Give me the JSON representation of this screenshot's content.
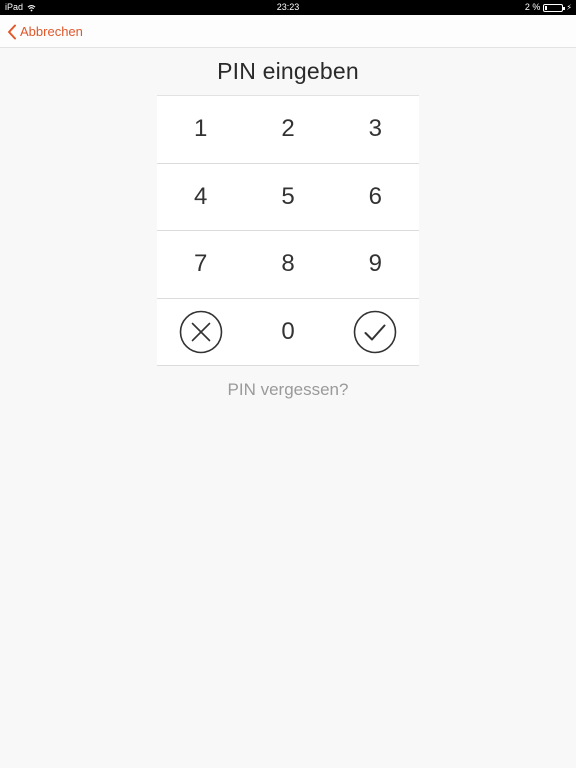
{
  "status_bar": {
    "device": "iPad",
    "time": "23:23",
    "battery": "2 %",
    "icons": [
      "wifi-icon",
      "battery-icon",
      "charging-icon"
    ]
  },
  "nav": {
    "back_label": "Abbrechen",
    "back_icon": "chevron-left-icon",
    "accent_color": "#e0572a"
  },
  "title": "PIN eingeben",
  "keypad": {
    "rows": [
      [
        "1",
        "2",
        "3"
      ],
      [
        "4",
        "5",
        "6"
      ],
      [
        "7",
        "8",
        "9"
      ]
    ],
    "bottom": {
      "clear_icon": "clear-circle-icon",
      "zero": "0",
      "confirm_icon": "check-circle-icon"
    }
  },
  "forgot_label": "PIN vergessen?"
}
